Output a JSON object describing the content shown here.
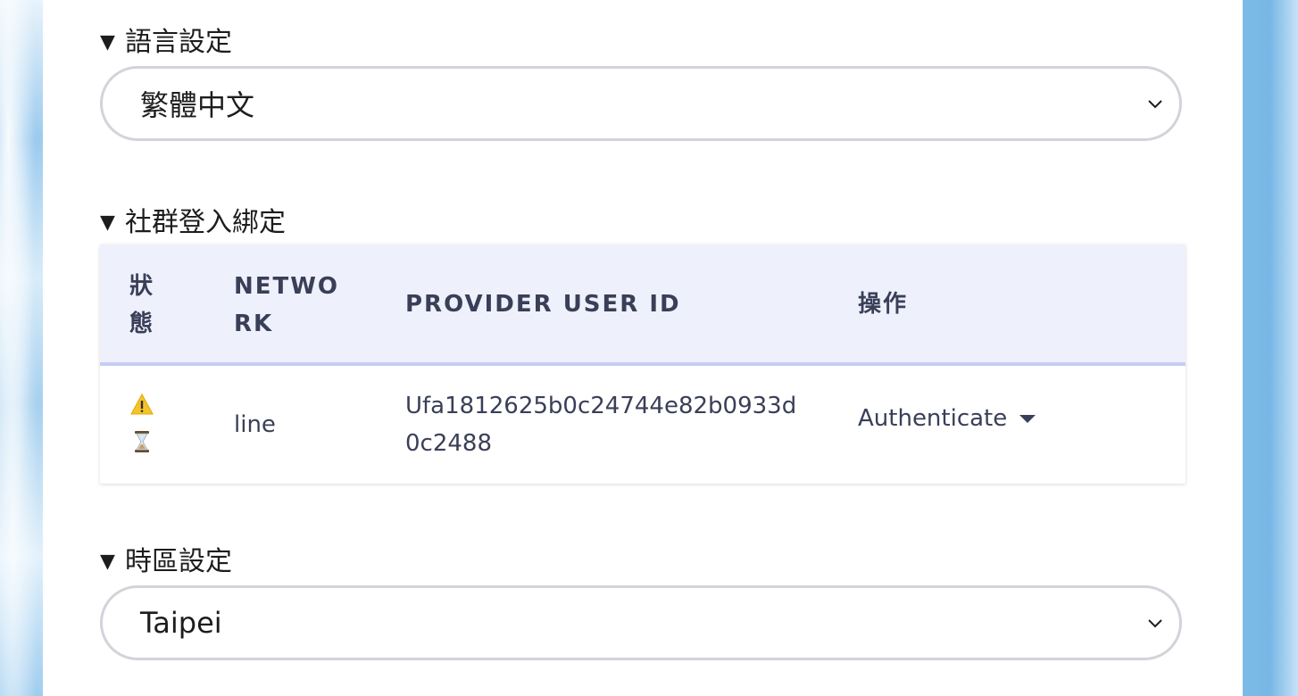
{
  "language_section": {
    "title": "語言設定",
    "selected": "繁體中文"
  },
  "social_section": {
    "title": "社群登入綁定",
    "table": {
      "headers": {
        "status_line1": "狀",
        "status_line2": "態",
        "network_line1": "NETWO",
        "network_line2": "RK",
        "provider_user_id": "PROVIDER USER ID",
        "action": "操作"
      },
      "rows": [
        {
          "status_icons": [
            "warning-icon",
            "hourglass-icon"
          ],
          "network": "line",
          "provider_user_id_line1": "Ufa1812625b0c24744e82b0933d",
          "provider_user_id_line2": "0c2488",
          "action": "Authenticate"
        }
      ]
    }
  },
  "timezone_section": {
    "title": "時區設定",
    "selected": "Taipei"
  },
  "colors": {
    "header_bg": "#eef0fb",
    "header_border": "#c5cdf3",
    "select_border": "#d3d3db",
    "text": "#3a3f58"
  }
}
